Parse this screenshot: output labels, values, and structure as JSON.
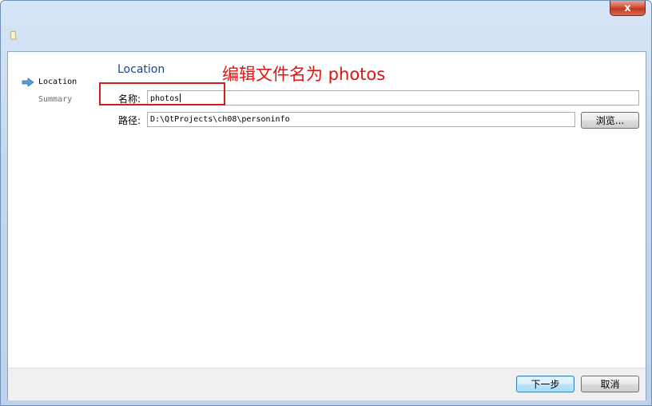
{
  "window": {
    "close_glyph": "x"
  },
  "sidebar": {
    "steps": [
      {
        "label": "Location",
        "active": true
      },
      {
        "label": "Summary",
        "active": false
      }
    ]
  },
  "main": {
    "title": "Location",
    "annotation": "编辑文件名为 photos",
    "name_field": {
      "label": "名称:",
      "value": "photos"
    },
    "path_field": {
      "label": "路径:",
      "value": "D:\\QtProjects\\ch08\\personinfo"
    },
    "browse_label": "浏览..."
  },
  "footer": {
    "next_label": "下一步",
    "cancel_label": "取消"
  },
  "colors": {
    "accent": "#1f3f8f",
    "annotation": "#e01414"
  }
}
